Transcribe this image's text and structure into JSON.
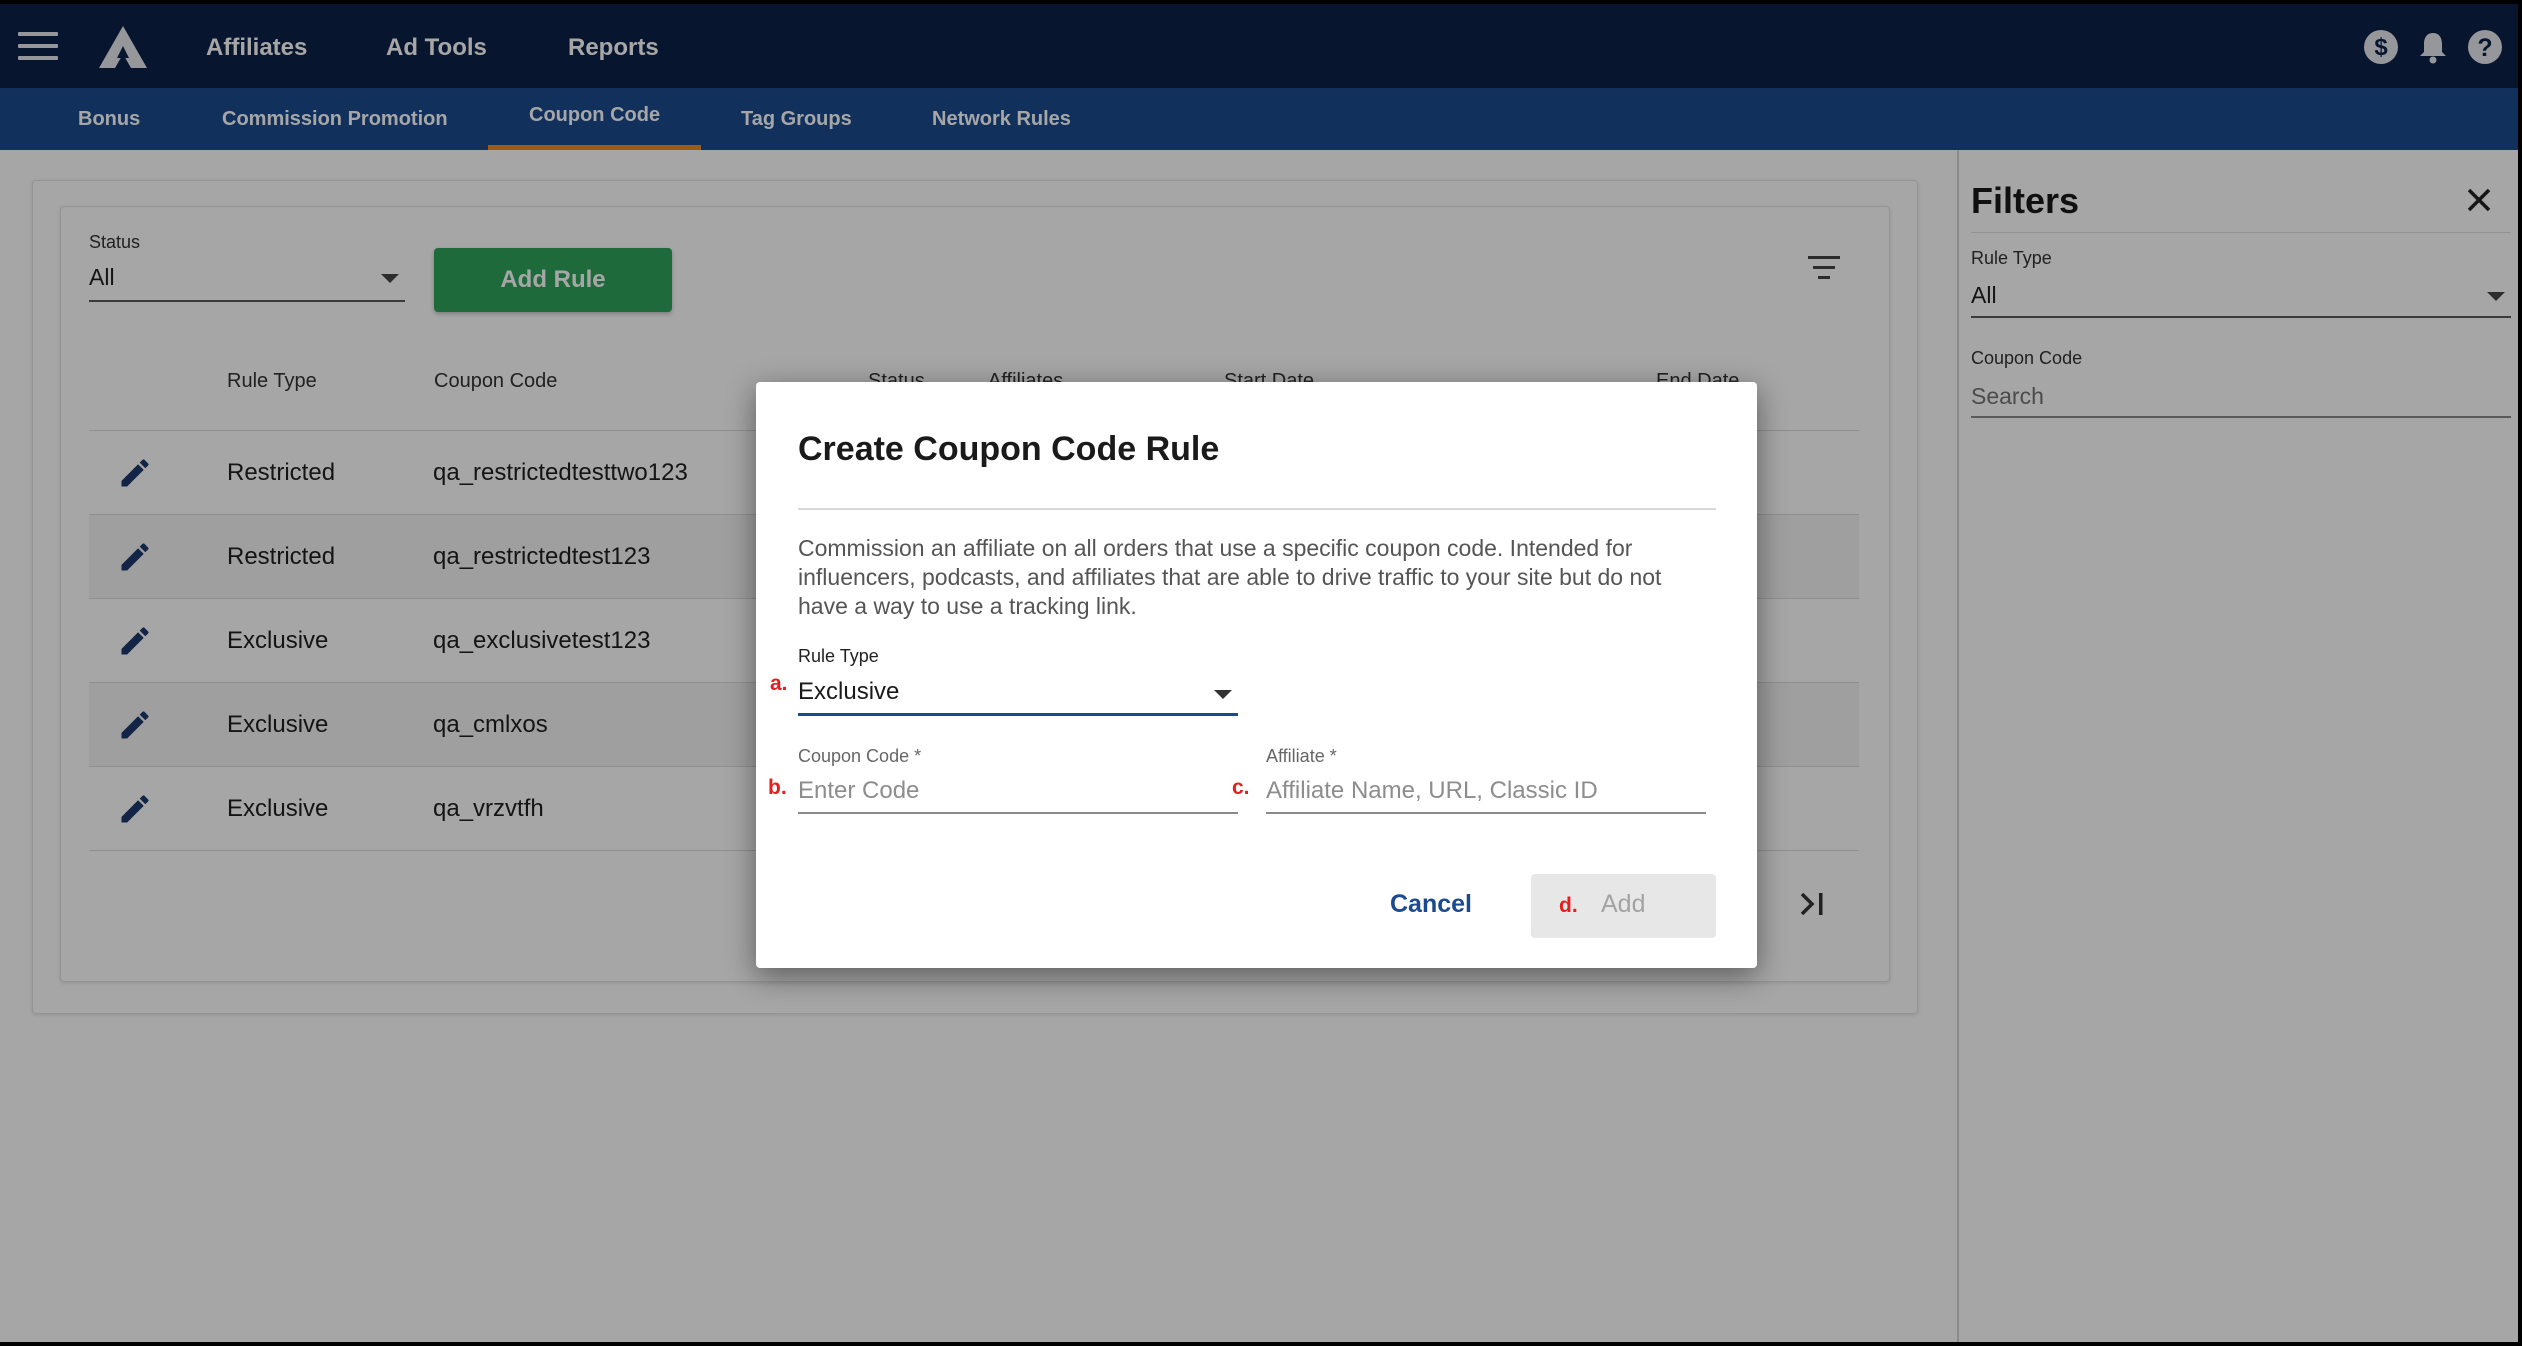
{
  "topbar": {
    "nav": [
      {
        "label": "Affiliates"
      },
      {
        "label": "Ad Tools"
      },
      {
        "label": "Reports"
      }
    ]
  },
  "subnav": {
    "tabs": [
      {
        "label": "Bonus"
      },
      {
        "label": "Commission Promotion"
      },
      {
        "label": "Coupon Code",
        "active": true
      },
      {
        "label": "Tag Groups"
      },
      {
        "label": "Network Rules"
      }
    ]
  },
  "toolbar": {
    "status_label": "Status",
    "status_value": "All",
    "add_rule_label": "Add Rule"
  },
  "table": {
    "headers": {
      "rule_type": "Rule Type",
      "coupon_code": "Coupon Code",
      "status": "Status",
      "affiliates": "Affiliates",
      "start_date": "Start Date",
      "end_date": "End Date"
    },
    "rows": [
      {
        "rule_type": "Restricted",
        "coupon_code": "qa_restrictedtesttwo123"
      },
      {
        "rule_type": "Restricted",
        "coupon_code": "qa_restrictedtest123"
      },
      {
        "rule_type": "Exclusive",
        "coupon_code": "qa_exclusivetest123"
      },
      {
        "rule_type": "Exclusive",
        "coupon_code": "qa_cmlxos"
      },
      {
        "rule_type": "Exclusive",
        "coupon_code": "qa_vrzvtfh"
      }
    ]
  },
  "filters": {
    "title": "Filters",
    "rule_type_label": "Rule Type",
    "rule_type_value": "All",
    "coupon_code_label": "Coupon Code",
    "coupon_code_placeholder": "Search"
  },
  "modal": {
    "title": "Create Coupon Code Rule",
    "description": "Commission an affiliate on all orders that use a specific coupon code. Intended for influencers, podcasts, and affiliates that are able to drive traffic to your site but do not have a way to use a tracking link.",
    "rule_type_label": "Rule Type",
    "rule_type_value": "Exclusive",
    "coupon_code_label": "Coupon Code *",
    "coupon_code_placeholder": "Enter Code",
    "affiliate_label": "Affiliate *",
    "affiliate_placeholder": "Affiliate Name, URL, Classic ID",
    "cancel_label": "Cancel",
    "add_label": "Add",
    "markers": {
      "a": "a.",
      "b": "b.",
      "c": "c.",
      "d": "d."
    }
  },
  "colors": {
    "topbar": "#0d2149",
    "subnav": "#1c4a8e",
    "active_tab_underline": "#f08c24",
    "add_rule_button": "#2fa45a",
    "annotation_marker": "#e22020"
  },
  "icons": {
    "menu": "hamburger-icon",
    "logo": "brand-logo",
    "currency": "dollar-icon",
    "notifications": "bell-icon",
    "help": "help-icon",
    "filter": "filter-list-icon",
    "edit": "pencil-icon",
    "close": "close-icon",
    "last_page": "last-page-icon"
  }
}
